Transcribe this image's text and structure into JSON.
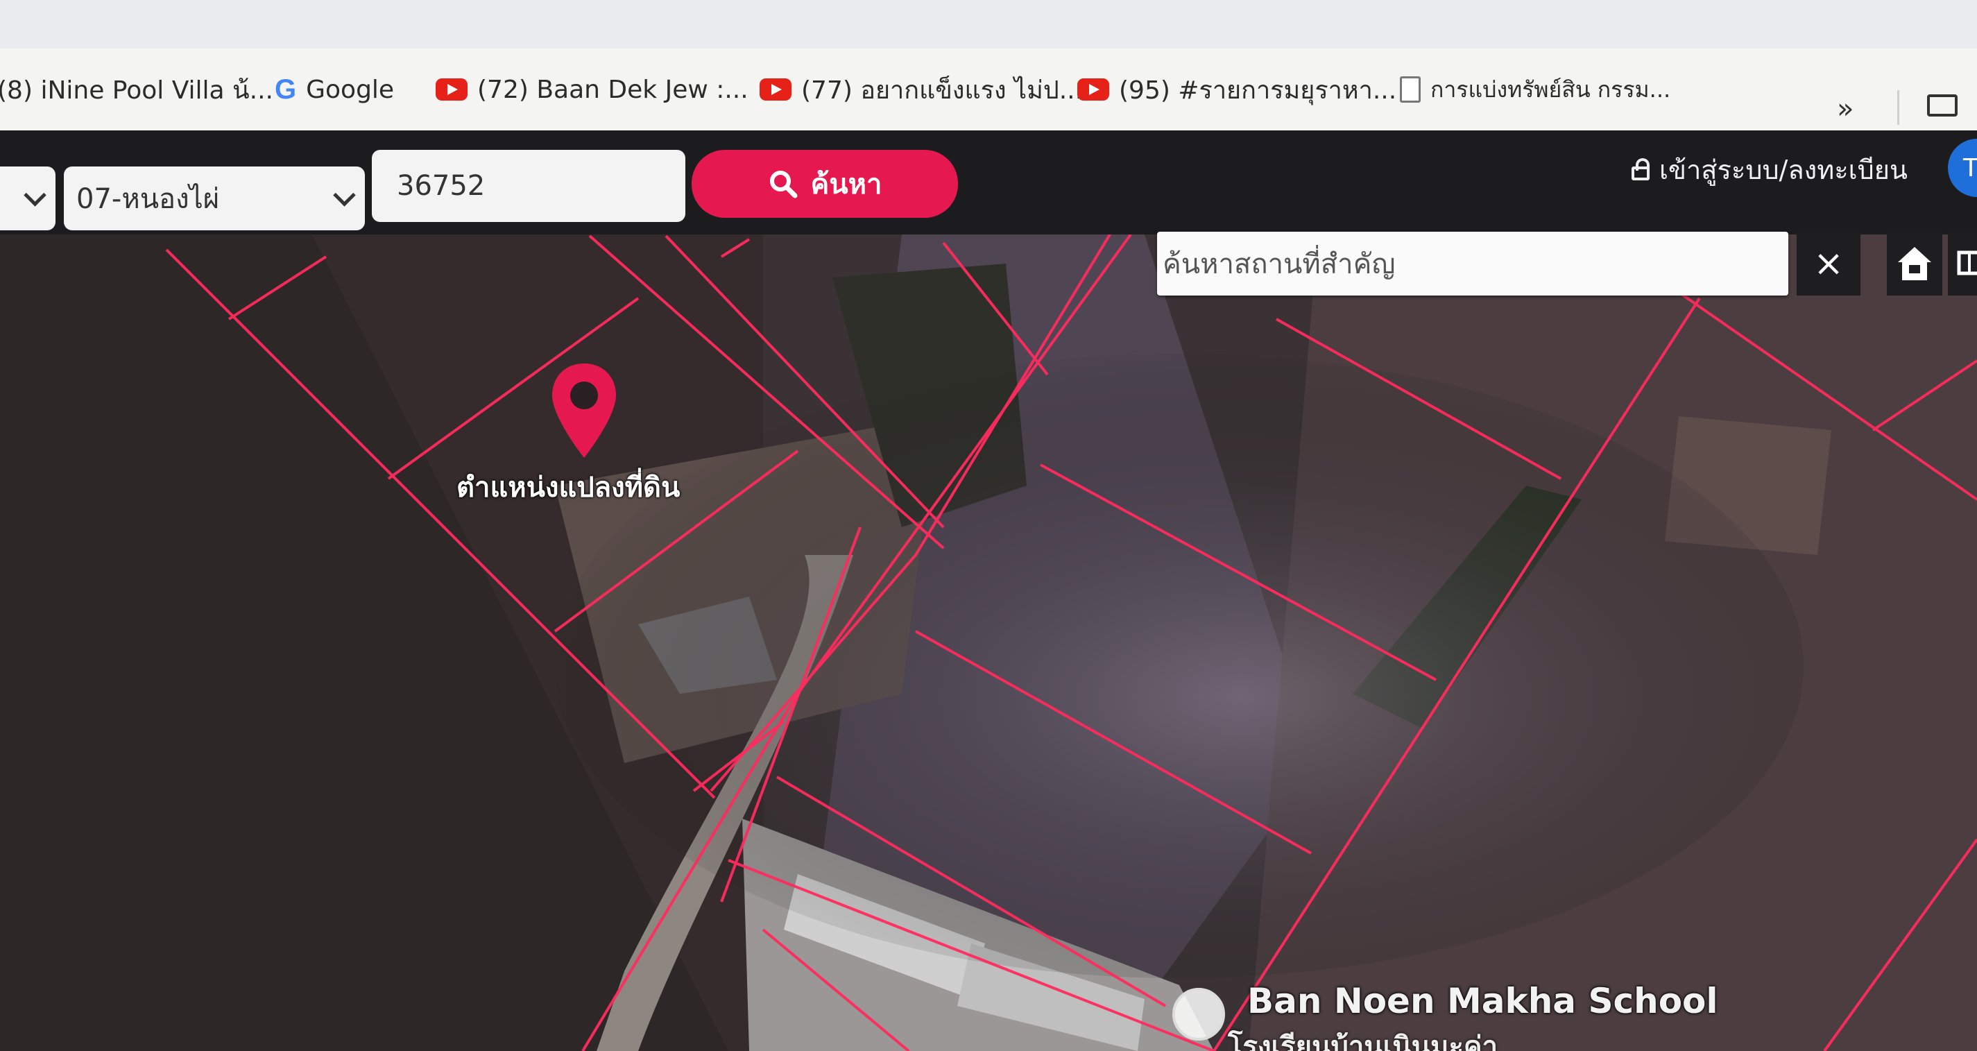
{
  "bookmarks": {
    "items": [
      {
        "label": "(8) iNine Pool Villa น้...",
        "icon": "bookmark-page-icon"
      },
      {
        "label": "Google",
        "icon": "google-icon"
      },
      {
        "label": "(72) Baan Dek Jew :...",
        "icon": "youtube-icon"
      },
      {
        "label": "(77) อยากแข็งแรง ไม่ป...",
        "icon": "youtube-icon"
      },
      {
        "label": "(95) #รายการมยุราหา...",
        "icon": "youtube-icon"
      },
      {
        "label": "การแบ่งทรัพย์สิน กรรม...",
        "icon": "document-icon"
      }
    ],
    "overflow_label": "»"
  },
  "toolbar": {
    "district_select": "07-หนองไผ่",
    "parcel_number": "36752",
    "search_button": "ค้นหา",
    "login_link": "เข้าสู่ระบบ/ลงทะเบียน",
    "avatar_initial": "T"
  },
  "map": {
    "place_search_placeholder": "ค้นหาสถานที่สำคัญ",
    "clear_label": "×",
    "marker_label": "ตำแหน่งแปลงที่ดิน",
    "poi": {
      "name": "Ban Noen Makha School",
      "thai_name": "โรงเรียนบ้านเนินมะค่า"
    }
  },
  "colors": {
    "accent": "#e5194f",
    "parcel_lines": "#ff2b5e",
    "toolbar_bg": "#1c1b1d"
  }
}
